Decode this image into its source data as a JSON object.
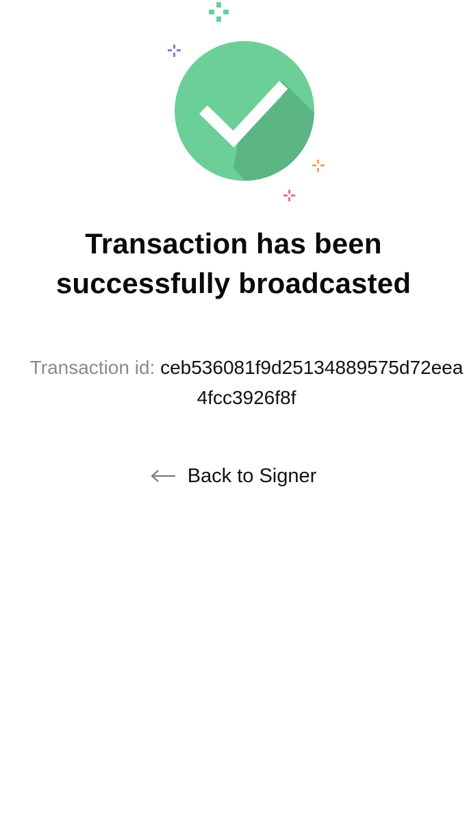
{
  "success": {
    "title_line1": "Transaction has been",
    "title_line2": "successfully broadcasted",
    "txid_label": "Transaction id:",
    "txid_value": "ceb536081f9d25134889575d72eea4fcc3926f8f",
    "back_label": "Back to Signer"
  },
  "icons": {
    "main": "check-circle-icon",
    "sparkles": [
      "sparkle-green-icon",
      "sparkle-purple-icon",
      "sparkle-orange-icon",
      "sparkle-red-icon"
    ],
    "back": "arrow-left-icon"
  },
  "colors": {
    "check_circle": "#6ccf98",
    "check_shadow": "#5bb585",
    "sparkle_green": "#6ccf98",
    "sparkle_purple": "#9b6bd3",
    "sparkle_orange": "#f5a25d",
    "sparkle_red": "#f06d7f",
    "label_gray": "#8a8a8a"
  }
}
